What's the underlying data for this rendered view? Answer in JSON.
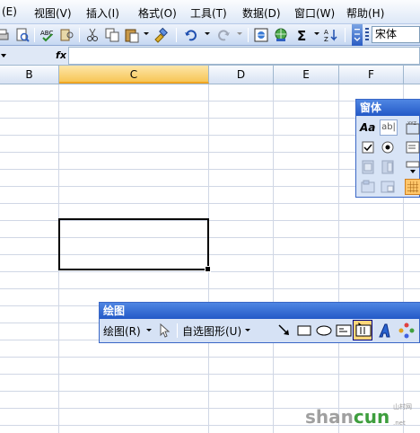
{
  "menu": {
    "items": [
      "(E)",
      "视图(V)",
      "插入(I)",
      "格式(O)",
      "工具(T)",
      "数据(D)",
      "窗口(W)",
      "帮助(H)"
    ]
  },
  "toolbar": {
    "font_name": "宋体"
  },
  "formula_bar": {
    "fx_label": "fx"
  },
  "columns": [
    "B",
    "C",
    "D",
    "E",
    "F"
  ],
  "selected_column": "C",
  "forms_toolbar": {
    "title": "窗体",
    "label_button_text": "Aa",
    "edit_box_text": "ab|"
  },
  "drawing_toolbar": {
    "title": "绘图",
    "draw_menu": "绘图(R)",
    "autoshapes_menu": "自选图形(U)"
  },
  "watermark": {
    "prefix": "shan",
    "suffix": "cun",
    "sub": "山村网",
    "domain": ".net"
  },
  "colors": {
    "accent_selected": "#f7c657",
    "titlebar_blue": "#2359c7",
    "grid_line": "#d0d7e5"
  }
}
